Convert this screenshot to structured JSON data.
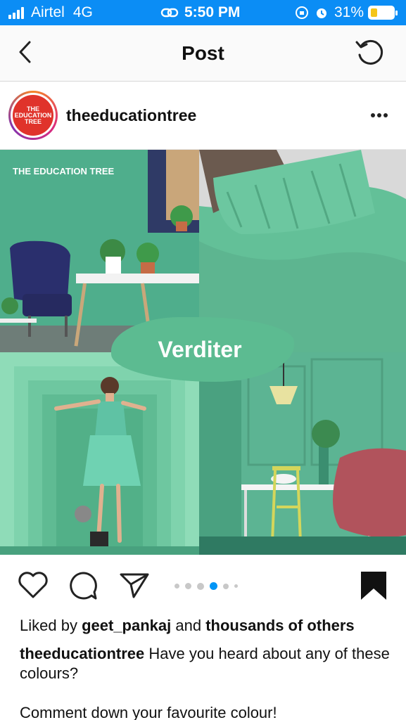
{
  "status": {
    "carrier": "Airtel",
    "network": "4G",
    "time": "5:50 PM",
    "battery": "31%"
  },
  "nav": {
    "title": "Post",
    "back_icon": "chevron-left-icon",
    "refresh_icon": "refresh-icon"
  },
  "post": {
    "avatar_text": "THE EDUCATION TREE",
    "username": "theeducationtree",
    "brand_watermark": "THE EDUCATION TREE",
    "image_label": "Verditer",
    "carousel": {
      "count": 6,
      "active_index": 3
    }
  },
  "actions": {
    "like_icon": "heart-icon",
    "comment_icon": "comment-icon",
    "share_icon": "send-icon",
    "save_icon": "bookmark-icon"
  },
  "likes": {
    "prefix": "Liked by",
    "user": "geet_pankaj",
    "connector": "and",
    "others": "thousands of others"
  },
  "caption": {
    "author": "theeducationtree",
    "text": "Have you heard about any of these colours?",
    "second_line": "Comment down your favourite colour!"
  },
  "colors": {
    "status_bar": "#0b8df5",
    "verditer": "#5cbb91",
    "active_dot": "#0095f6"
  }
}
